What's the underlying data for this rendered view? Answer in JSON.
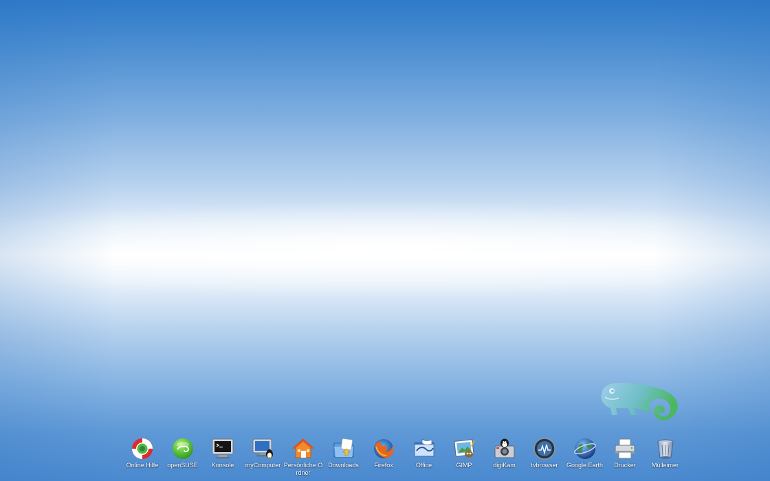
{
  "desktop": {
    "icons": [
      {
        "label": "Online Hilfe",
        "icon": "lifebuoy-icon"
      },
      {
        "label": "openSUSE",
        "icon": "opensuse-icon"
      },
      {
        "label": "Konsole",
        "icon": "terminal-icon"
      },
      {
        "label": "myComputer",
        "icon": "computer-icon"
      },
      {
        "label": "Persönliche Ordner",
        "icon": "home-folder-icon"
      },
      {
        "label": "Downloads",
        "icon": "downloads-folder-icon"
      },
      {
        "label": "Firefox",
        "icon": "firefox-icon"
      },
      {
        "label": "Office",
        "icon": "office-icon"
      },
      {
        "label": "GIMP",
        "icon": "gimp-icon"
      },
      {
        "label": "digiKam",
        "icon": "camera-icon"
      },
      {
        "label": "tvbrowser",
        "icon": "tvbrowser-icon"
      },
      {
        "label": "Google Earth",
        "icon": "globe-icon"
      },
      {
        "label": "Drucker",
        "icon": "printer-icon"
      },
      {
        "label": "Mülleimer",
        "icon": "trash-icon"
      }
    ]
  },
  "colors": {
    "sky_top": "#2e7ac9",
    "sky_center": "#ffffff",
    "logo_green": "#3fb64a"
  }
}
